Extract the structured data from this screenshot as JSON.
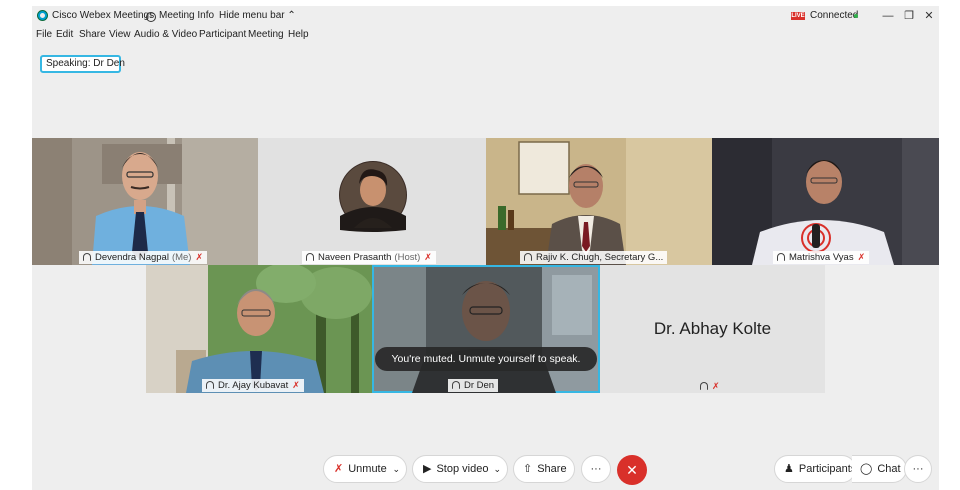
{
  "titlebar": {
    "app_name": "Cisco Webex Meetings",
    "meeting_info": "Meeting Info",
    "hide_menu": "Hide menu bar",
    "live_badge": "LIVE",
    "status": "Connected",
    "minimize": "—",
    "restore": "❐",
    "close": "✕"
  },
  "menu": [
    "File",
    "Edit",
    "Share",
    "View",
    "Audio & Video",
    "Participant",
    "Meeting",
    "Help"
  ],
  "speaking": "Speaking: Dr Den",
  "participants": [
    {
      "name": "Devendra Nagpal",
      "tag": "(Me)"
    },
    {
      "name": "Naveen Prasanth",
      "tag": "(Host)"
    },
    {
      "name": "Rajiv K. Chugh, Secretary G...",
      "tag": ""
    },
    {
      "name": "Matrishva Vyas",
      "tag": ""
    },
    {
      "name": "Dr. Ajay Kubavat",
      "tag": ""
    },
    {
      "name": "Dr Den",
      "tag": ""
    },
    {
      "name": "Dr. Abhay Kolte",
      "tag": ""
    }
  ],
  "mute_toast": "You're muted. Unmute yourself to speak.",
  "controls": {
    "unmute": "Unmute",
    "stop_video": "Stop video",
    "share": "Share",
    "more": "···",
    "end": "✕",
    "participants": "Participants",
    "chat": "Chat",
    "overflow": "···"
  },
  "colors": {
    "accent": "#36b7e3",
    "end_call": "#d9302a",
    "connected": "#2fb14a"
  }
}
